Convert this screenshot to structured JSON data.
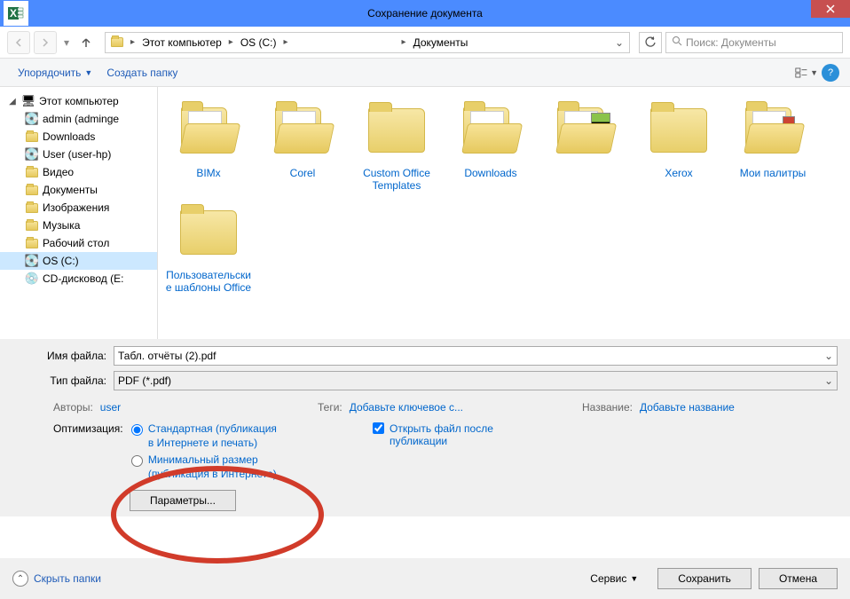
{
  "titlebar": {
    "title": "Сохранение документа"
  },
  "nav": {
    "breadcrumb": [
      "Этот компьютер",
      "OS (C:)",
      "",
      "Документы"
    ],
    "search_placeholder": "Поиск: Документы"
  },
  "toolbar": {
    "organize": "Упорядочить",
    "new_folder": "Создать папку"
  },
  "sidebar": {
    "items": [
      {
        "label": "Этот компьютер",
        "icon": "pc",
        "level": 0,
        "expanded": true
      },
      {
        "label": "admin (adminge",
        "icon": "drive",
        "level": 1
      },
      {
        "label": "Downloads",
        "icon": "folder",
        "level": 1
      },
      {
        "label": "User (user-hp)",
        "icon": "drive",
        "level": 1
      },
      {
        "label": "Видео",
        "icon": "folder",
        "level": 1
      },
      {
        "label": "Документы",
        "icon": "folder",
        "level": 1
      },
      {
        "label": "Изображения",
        "icon": "folder",
        "level": 1
      },
      {
        "label": "Музыка",
        "icon": "folder",
        "level": 1
      },
      {
        "label": "Рабочий стол",
        "icon": "folder",
        "level": 1
      },
      {
        "label": "OS (C:)",
        "icon": "drive",
        "level": 1,
        "selected": true
      },
      {
        "label": "CD-дисковод (E:",
        "icon": "disc",
        "level": 1
      }
    ]
  },
  "content": {
    "items": [
      {
        "label": "BIMx",
        "type": "folder-open"
      },
      {
        "label": "Corel",
        "type": "folder-open"
      },
      {
        "label": "Custom Office Templates",
        "type": "folder"
      },
      {
        "label": "Downloads",
        "type": "folder-open"
      },
      {
        "label": "",
        "type": "folder-preview"
      },
      {
        "label": "Xerox",
        "type": "folder"
      },
      {
        "label": "Мои палитры",
        "type": "folder-preview-small"
      },
      {
        "label": "Пользовательские шаблоны Office",
        "type": "folder"
      }
    ]
  },
  "form": {
    "filename_label": "Имя файла:",
    "filename_value": "Табл. отчёты (2).pdf",
    "filetype_label": "Тип файла:",
    "filetype_value": "PDF (*.pdf)"
  },
  "meta": {
    "authors_label": "Авторы:",
    "authors_value": "user",
    "tags_label": "Теги:",
    "tags_value": "Добавьте ключевое с...",
    "title_label": "Название:",
    "title_value": "Добавьте название"
  },
  "optimize": {
    "label": "Оптимизация:",
    "standard": "Стандартная (публикация в Интернете и печать)",
    "minimal": "Минимальный размер (публикация в Интернете)",
    "open_after": "Открыть файл после публикации",
    "params_btn": "Параметры..."
  },
  "footer": {
    "hide_folders": "Скрыть папки",
    "service": "Сервис",
    "save": "Сохранить",
    "cancel": "Отмена"
  }
}
